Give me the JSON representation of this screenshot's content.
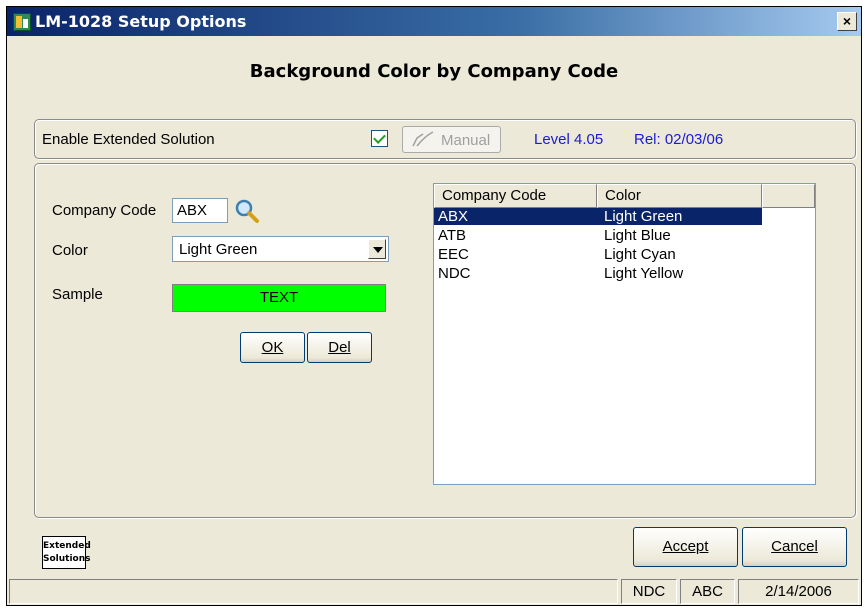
{
  "window": {
    "title": "LM-1028 Setup Options",
    "close_glyph": "×"
  },
  "heading": "Background Color by Company Code",
  "enable": {
    "label": "Enable Extended Solution",
    "checked": true,
    "manual_label": "Manual",
    "level": "Level 4.05",
    "rel": "Rel: 02/03/06"
  },
  "form": {
    "company_code_label": "Company Code",
    "company_code_value": "ABX",
    "color_label": "Color",
    "color_value": "Light Green",
    "sample_label": "Sample",
    "sample_text": "TEXT",
    "sample_color": "#00ff00",
    "ok_label": "OK",
    "del_label": "Del"
  },
  "grid": {
    "headers": [
      "Company Code",
      "Color"
    ],
    "rows": [
      {
        "code": "ABX",
        "color": "Light Green"
      },
      {
        "code": "ATB",
        "color": "Light Blue"
      },
      {
        "code": "EEC",
        "color": "Light Cyan"
      },
      {
        "code": "NDC",
        "color": "Light Yellow"
      }
    ],
    "selected_index": 0
  },
  "logo": {
    "line1": "Extended",
    "line2": "Solutions"
  },
  "buttons": {
    "accept": "Accept",
    "cancel": "Cancel"
  },
  "status": {
    "field1": "NDC",
    "field2": "ABC",
    "date": "2/14/2006"
  },
  "colors": {
    "link_blue": "#1a1ad8",
    "selection": "#0a246a"
  }
}
